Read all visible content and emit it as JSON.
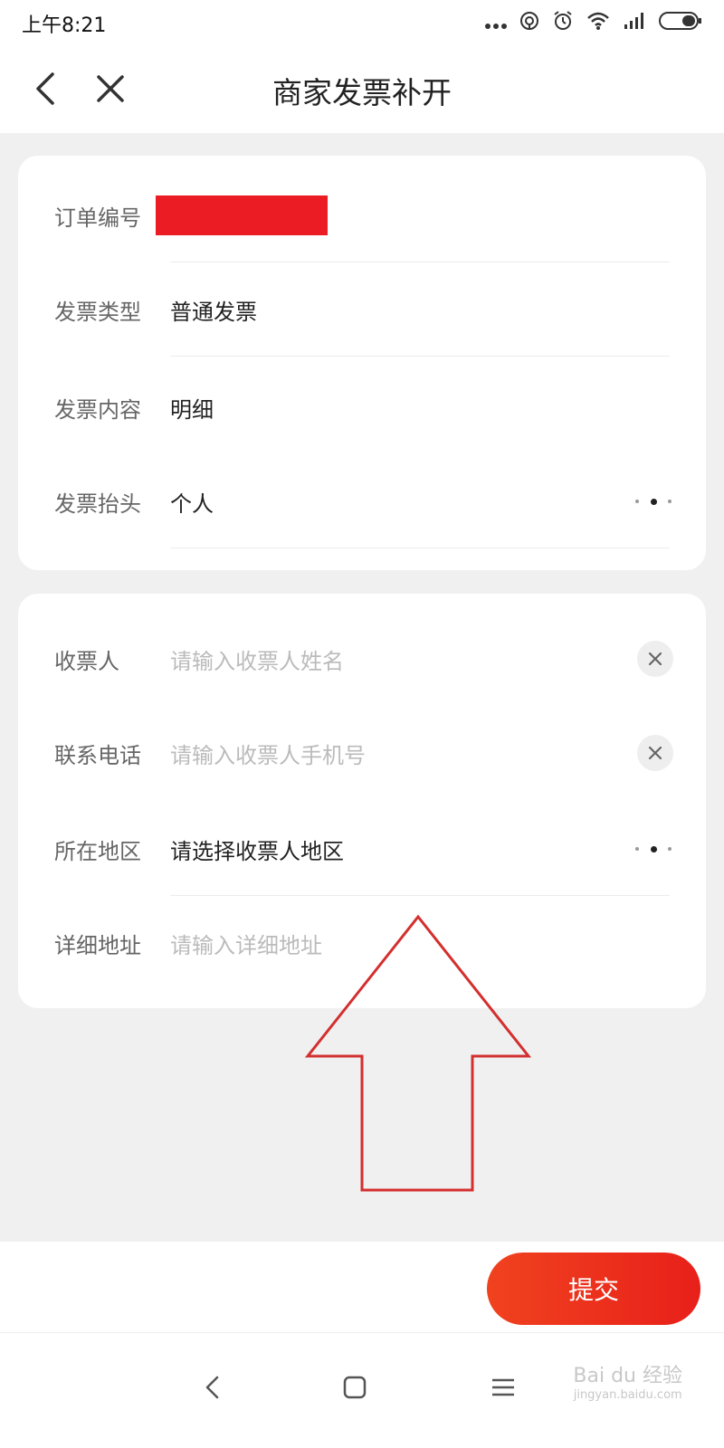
{
  "status_bar": {
    "time": "上午8:21",
    "icons": [
      "more-dots-icon",
      "hotspot-icon",
      "alarm-icon",
      "wifi-icon",
      "signal-icon",
      "battery-icon"
    ]
  },
  "header": {
    "title": "商家发票补开",
    "icons": [
      "back-icon",
      "close-icon"
    ]
  },
  "invoice_card": {
    "rows": [
      {
        "label": "订单编号",
        "value": ""
      },
      {
        "label": "发票类型",
        "value": "普通发票"
      },
      {
        "label": "发票内容",
        "value": "明细"
      },
      {
        "label": "发票抬头",
        "value": "个人"
      }
    ]
  },
  "recipient_card": {
    "rows": [
      {
        "label": "收票人",
        "placeholder": "请输入收票人姓名"
      },
      {
        "label": "联系电话",
        "placeholder": "请输入收票人手机号"
      },
      {
        "label": "所在地区",
        "value": "请选择收票人地区"
      },
      {
        "label": "详细地址",
        "placeholder": "请输入详细地址"
      }
    ]
  },
  "actions": {
    "submit_label": "提交"
  },
  "watermark": {
    "main": "Bai du 经验",
    "sub": "jingyan.baidu.com"
  },
  "colors": {
    "accent": "#e8201a",
    "redaction": "#ec1c24",
    "annotation_arrow": "#d32f2f",
    "background": "#f0f0f0"
  }
}
